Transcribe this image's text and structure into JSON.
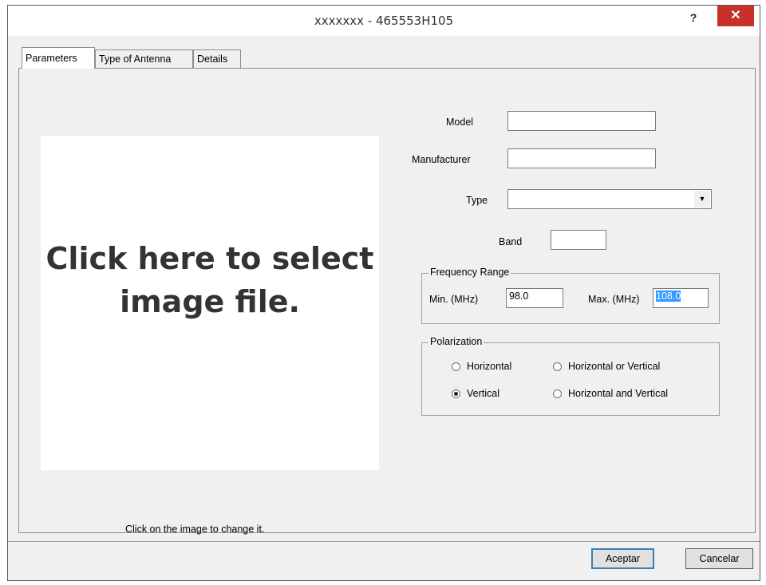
{
  "window": {
    "title": "xxxxxxx - 465553H105",
    "help_label": "?",
    "close_label": "✕"
  },
  "tabs": [
    {
      "label": "Parameters",
      "active": true
    },
    {
      "label": "Type of Antenna",
      "active": false
    },
    {
      "label": "Details",
      "active": false
    }
  ],
  "image_area": {
    "line1": "Click here to select",
    "line2": "image file.",
    "caption": "Click on the image to change it."
  },
  "fields": {
    "model": {
      "label": "Model",
      "value": ""
    },
    "manufacturer": {
      "label": "Manufacturer",
      "value": ""
    },
    "type": {
      "label": "Type",
      "value": "",
      "icon": "chevron-down-icon"
    },
    "band": {
      "label": "Band",
      "value": ""
    }
  },
  "frequency_range": {
    "title": "Frequency Range",
    "min_label": "Min. (MHz)",
    "min_value": "98.0",
    "max_label": "Max. (MHz)",
    "max_value": "108.0"
  },
  "polarization": {
    "title": "Polarization",
    "options": [
      {
        "label": "Horizontal",
        "checked": false
      },
      {
        "label": "Horizontal or Vertical",
        "checked": false
      },
      {
        "label": "Vertical",
        "checked": true
      },
      {
        "label": "Horizontal and Vertical",
        "checked": false
      }
    ]
  },
  "buttons": {
    "ok": "Aceptar",
    "cancel": "Cancelar"
  },
  "colors": {
    "close_button": "#c7302b",
    "selection": "#3399ff",
    "dialog_bg": "#f0f0f0"
  }
}
